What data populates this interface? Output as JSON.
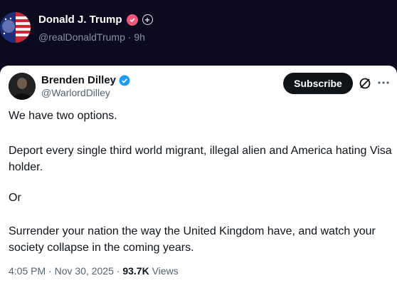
{
  "outer_post": {
    "display_name": "Donald J. Trump",
    "handle": "@realDonaldTrump",
    "separator": "·",
    "time_ago": "9h"
  },
  "quoted_post": {
    "author_name": "Brenden Dilley",
    "author_handle": "@WarlordDilley",
    "subscribe_label": "Subscribe",
    "paragraphs": [
      "We have two options.",
      "Deport every single third world migrant, illegal alien and America hating Visa holder.",
      "Or",
      "Surrender your nation the way the United Kingdom have, and watch your society collapse in the coming years."
    ],
    "time": "4:05 PM",
    "date": "Nov 30, 2025",
    "dot": "·",
    "views_count": "93.7K",
    "views_label": "Views"
  },
  "colors": {
    "background": "#0c0a1e",
    "verified_blue": "#1d9bf0",
    "pink_badge": "#f2567b"
  }
}
